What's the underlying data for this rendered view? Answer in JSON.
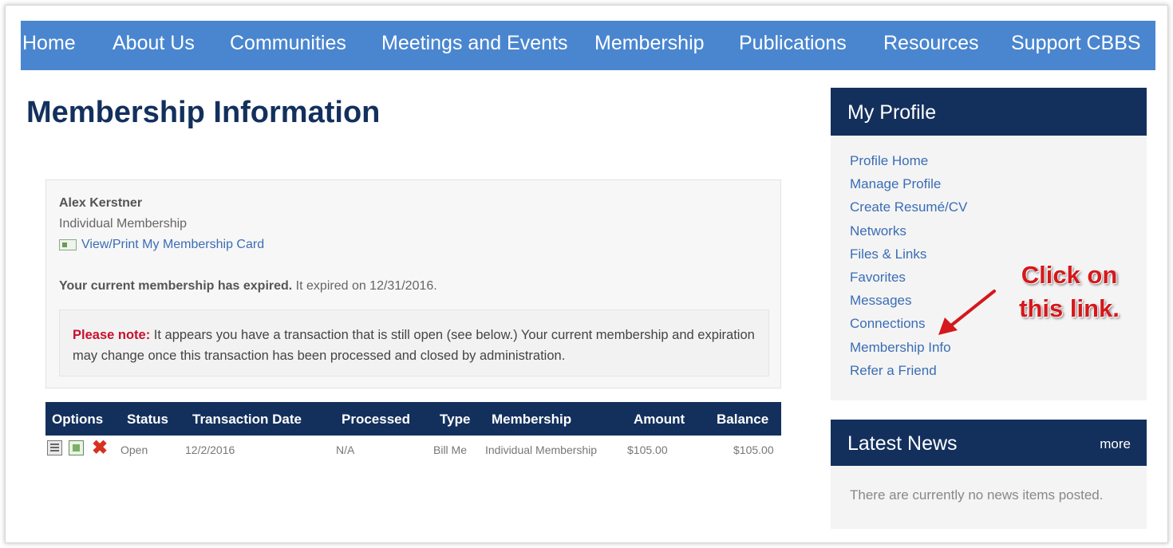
{
  "nav": {
    "items": [
      "Home",
      "About Us",
      "Communities",
      "Meetings and Events",
      "Membership",
      "Publications",
      "Resources",
      "Support CBBS"
    ]
  },
  "page_title": "Membership Information",
  "member": {
    "name": "Alex Kerstner",
    "type": "Individual Membership",
    "card_link": "View/Print My Membership Card",
    "expired_bold": "Your current membership has expired.",
    "expired_rest": " It expired on 12/31/2016.",
    "note_label": "Please note:",
    "note_text": " It appears you have a transaction that is still open (see below.) Your current membership and expiration may change once this transaction has been processed and closed by administration."
  },
  "transactions": {
    "headers": [
      "Options",
      "Status",
      "Transaction Date",
      "Processed",
      "Type",
      "Membership",
      "Amount",
      "Balance"
    ],
    "rows": [
      {
        "status": "Open",
        "date": "12/2/2016",
        "processed": "N/A",
        "type": "Bill Me",
        "membership": "Individual Membership",
        "amount": "$105.00",
        "balance": "$105.00"
      }
    ]
  },
  "profile": {
    "title": "My Profile",
    "links": [
      "Profile Home",
      "Manage Profile",
      "Create Resumé/CV",
      "Networks",
      "Files & Links",
      "Favorites",
      "Messages",
      "Connections",
      "Membership Info",
      "Refer a Friend"
    ]
  },
  "news": {
    "title": "Latest News",
    "more": "more",
    "text": "There are currently no news items posted."
  },
  "callout": {
    "line1": "Click on",
    "line2": "this link."
  },
  "colors": {
    "nav_blue": "#4a86d0",
    "navy": "#13305d",
    "link_blue": "#3a6db5",
    "alert_red": "#c8102e",
    "callout_red": "#d4181c"
  },
  "icons": [
    "membership-card-icon",
    "view-icon",
    "pay-icon",
    "delete-icon",
    "arrow-icon"
  ]
}
